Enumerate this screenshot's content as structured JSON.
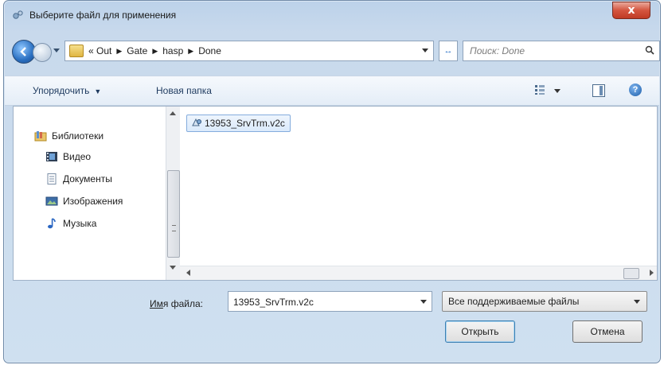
{
  "window": {
    "title": "Выберите файл для применения",
    "close_label": "x"
  },
  "address": {
    "crumbs": [
      "«",
      "Out",
      "Gate",
      "hasp",
      "Done"
    ],
    "search_placeholder": "Поиск: Done"
  },
  "toolbar": {
    "organize_label": "Упорядочить",
    "organize_arrow": "▼",
    "new_folder_label": "Новая папка",
    "help_label": "?"
  },
  "nav": {
    "items": [
      {
        "label": "Библиотеки",
        "icon": "libraries-icon"
      },
      {
        "label": "Видео",
        "icon": "video-icon"
      },
      {
        "label": "Документы",
        "icon": "documents-icon"
      },
      {
        "label": "Изображения",
        "icon": "pictures-icon"
      },
      {
        "label": "Музыка",
        "icon": "music-icon"
      }
    ]
  },
  "files": [
    {
      "name": "13953_SrvTrm.v2c",
      "icon": "v2c-file-icon",
      "selected": true
    }
  ],
  "footer": {
    "filename_label_prefix": "Им",
    "filename_label_rest": "я файла:",
    "filename_value": "13953_SrvTrm.v2c",
    "filter_label": "Все поддерживаемые файлы",
    "open_label": "Открыть",
    "cancel_label": "Отмена"
  },
  "colors": {
    "accent": "#3c7fb1",
    "selection": "#dbeafb",
    "close": "#c8452f"
  }
}
